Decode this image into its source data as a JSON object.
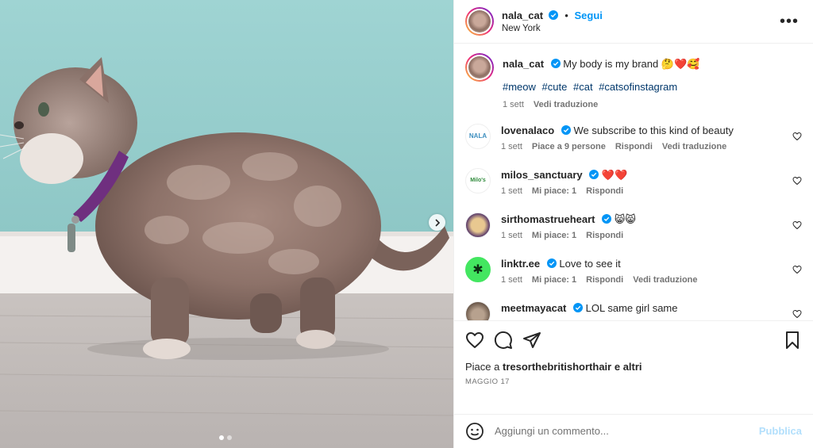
{
  "header": {
    "username": "nala_cat",
    "separator": "•",
    "follow_label": "Segui",
    "location": "New York",
    "more_label": "•••"
  },
  "caption": {
    "username": "nala_cat",
    "text": "My body is my brand 🤔❤️🥰",
    "hashtags": [
      "#meow",
      "#cute",
      "#cat",
      "#catsofinstagram"
    ],
    "time": "1 sett",
    "translate": "Vedi traduzione"
  },
  "comments": [
    {
      "username": "lovenalaco",
      "text": "We subscribe to this kind of beauty",
      "time": "1 sett",
      "likes": "Piace a 9 persone",
      "reply": "Rispondi",
      "translate": "Vedi traduzione",
      "avatar_text": "NALA"
    },
    {
      "username": "milos_sanctuary",
      "text": "❤️❤️",
      "time": "1 sett",
      "likes": "Mi piace: 1",
      "reply": "Rispondi",
      "avatar_text": "Milo's"
    },
    {
      "username": "sirthomastrueheart",
      "text": "😸😸",
      "time": "1 sett",
      "likes": "Mi piace: 1",
      "reply": "Rispondi"
    },
    {
      "username": "linktr.ee",
      "text": "Love to see it",
      "time": "1 sett",
      "likes": "Mi piace: 1",
      "reply": "Rispondi",
      "translate": "Vedi traduzione",
      "avatar_text": "✱"
    },
    {
      "username": "meetmayacat",
      "text": "LOL same girl same"
    }
  ],
  "footer": {
    "likes_prefix": "Piace a ",
    "likes_user": "tresorthebritishorthair",
    "likes_suffix": " e altri",
    "date": "MAGGIO 17",
    "comment_placeholder": "Aggiungi un commento...",
    "publish_label": "Pubblica"
  },
  "colors": {
    "accent": "#0095f6",
    "verified": "#0095f6",
    "hashtag": "#00376b",
    "secondary_text": "#737373",
    "publish_disabled": "#b2dffc"
  },
  "carousel": {
    "slides": 2,
    "current": 1
  }
}
